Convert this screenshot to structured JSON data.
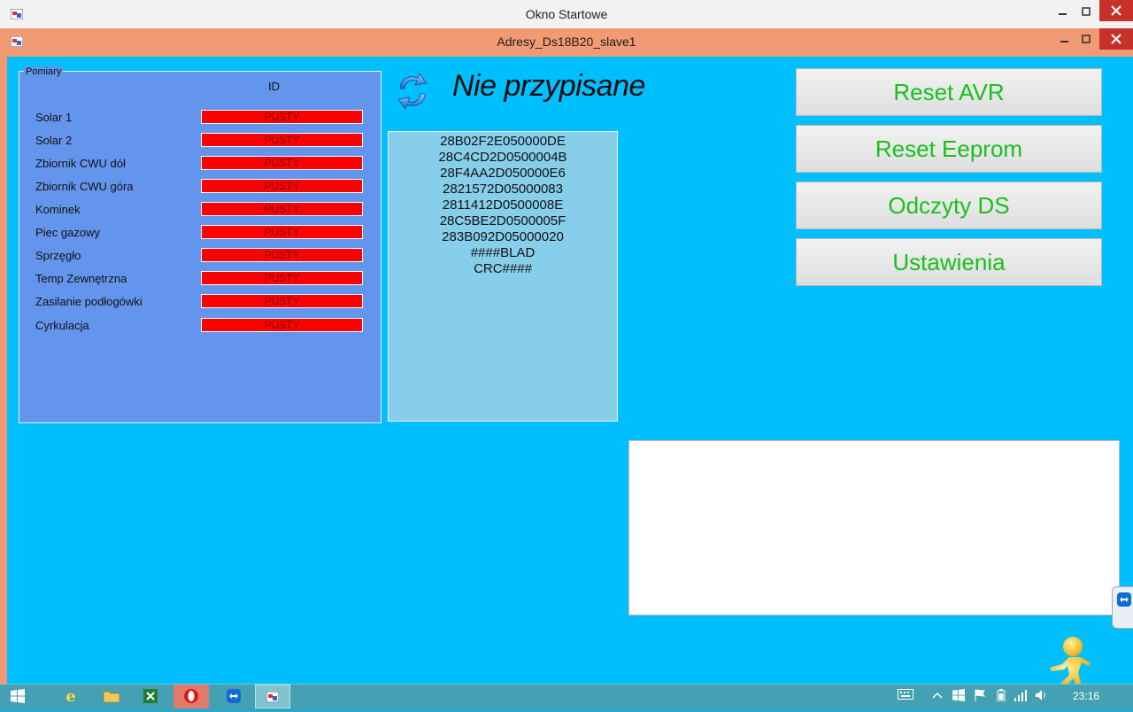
{
  "outer_window": {
    "title": "Okno Startowe"
  },
  "inner_window": {
    "title": "Adresy_Ds18B20_slave1"
  },
  "group": {
    "legend": "Pomiary",
    "id_header": "ID",
    "rows": [
      {
        "label": "Solar 1",
        "value": "PUSTY"
      },
      {
        "label": "Solar 2",
        "value": "PUSTY"
      },
      {
        "label": "Zbiornik CWU dół",
        "value": "PUSTY"
      },
      {
        "label": "Zbiornik CWU góra",
        "value": "PUSTY"
      },
      {
        "label": "Kominek",
        "value": "PUSTY"
      },
      {
        "label": "Piec gazowy",
        "value": "PUSTY"
      },
      {
        "label": "Sprzęgło",
        "value": "PUSTY"
      },
      {
        "label": "Temp Zewnętrzna",
        "value": "PUSTY"
      },
      {
        "label": "Zasilanie podłogówki",
        "value": "PUSTY"
      },
      {
        "label": "Cyrkulacja",
        "value": "PUSTY"
      }
    ]
  },
  "status": {
    "text": "Nie przypisane"
  },
  "address_list": [
    "28B02F2E050000DE",
    "28C4CD2D0500004B",
    "28F4AA2D050000E6",
    "2821572D05000083",
    "2811412D0500008E",
    "28C5BE2D0500005F",
    "283B092D05000020",
    "####BLAD",
    "CRC####"
  ],
  "buttons": {
    "reset_avr": "Reset AVR",
    "reset_eeprom": "Reset Eeprom",
    "odczyty_ds": "Odczyty DS",
    "ustawienia": "Ustawienia"
  },
  "taskbar": {
    "clock": "23:16"
  },
  "colors": {
    "client_bg": "#00bfff",
    "group_bg": "#6495ed",
    "list_bg": "#87ceeb",
    "empty_cell": "#ff0000",
    "button_text": "#19c01b",
    "inner_frame": "#f29a73"
  }
}
